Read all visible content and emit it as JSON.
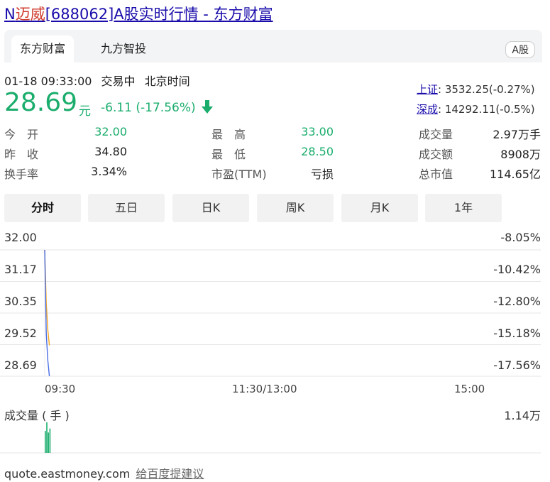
{
  "page": {
    "title_prefix": "N",
    "title_highlight": "迈威",
    "title_suffix": "[688062]A股实时行情 - 东方财富"
  },
  "tabs": [
    {
      "label": "东方财富",
      "active": true
    },
    {
      "label": "九方智投",
      "active": false
    }
  ],
  "market_badge": "A股",
  "status": {
    "time": "01-18 09:33:00",
    "state": "交易中",
    "tz": "北京时间"
  },
  "quote": {
    "price": "28.69",
    "unit": "元",
    "change": "-6.11 (-17.56%)",
    "direction": "down"
  },
  "indices": [
    {
      "name": "上证",
      "value": ": 3532.25(-0.27%)"
    },
    {
      "name": "深成",
      "value": ": 14292.11(-0.5%)"
    }
  ],
  "stats": [
    {
      "label": "今　开",
      "value": "32.00",
      "color": "green"
    },
    {
      "label": "最　高",
      "value": "33.00",
      "color": "green"
    },
    {
      "label": "成交量",
      "value": "2.97万手",
      "color": "dark"
    },
    {
      "label": "昨　收",
      "value": "34.80",
      "color": "dark"
    },
    {
      "label": "最　低",
      "value": "28.50",
      "color": "green"
    },
    {
      "label": "成交额",
      "value": "8908万",
      "color": "dark"
    },
    {
      "label": "换手率",
      "value": "3.34%",
      "color": "dark"
    },
    {
      "label": "市盈(TTM)",
      "value": "亏损",
      "color": "dark"
    },
    {
      "label": "总市值",
      "value": "114.65亿",
      "color": "dark"
    }
  ],
  "period_tabs": [
    {
      "label": "分时",
      "active": true
    },
    {
      "label": "五日",
      "active": false
    },
    {
      "label": "日K",
      "active": false
    },
    {
      "label": "周K",
      "active": false
    },
    {
      "label": "月K",
      "active": false
    },
    {
      "label": "1年",
      "active": false
    }
  ],
  "chart_data": {
    "type": "line",
    "y_left_ticks": [
      "32.00",
      "31.17",
      "30.35",
      "29.52",
      "28.69"
    ],
    "y_right_ticks": [
      "-8.05%",
      "-10.42%",
      "-12.80%",
      "-15.18%",
      "-17.56%"
    ],
    "ylim": [
      28.69,
      32.0
    ],
    "x_ticks": [
      "09:30",
      "11:30/13:00",
      "15:00"
    ],
    "x_minutes": [
      0,
      120,
      240
    ],
    "series": [
      {
        "color": "#f5a623",
        "x": [
          0,
          1,
          2,
          3
        ],
        "y": [
          32.0,
          30.6,
          29.9,
          29.5
        ]
      },
      {
        "color": "#4a6fe3",
        "x": [
          0,
          1,
          2,
          3
        ],
        "y": [
          32.0,
          29.8,
          29.1,
          28.69
        ]
      }
    ],
    "volume_label": "成交量 ( 手 )",
    "volume_max_label": "1.14万",
    "volume_max": 11400,
    "volume": [
      8200,
      11400,
      7600,
      9100
    ],
    "grid": true
  },
  "footer": {
    "site": "quote.eastmoney.com",
    "feedback": "给百度提建议"
  },
  "colors": {
    "down": "#1aad6c",
    "link": "#1a0dab",
    "highlight": "#d03a2c"
  }
}
